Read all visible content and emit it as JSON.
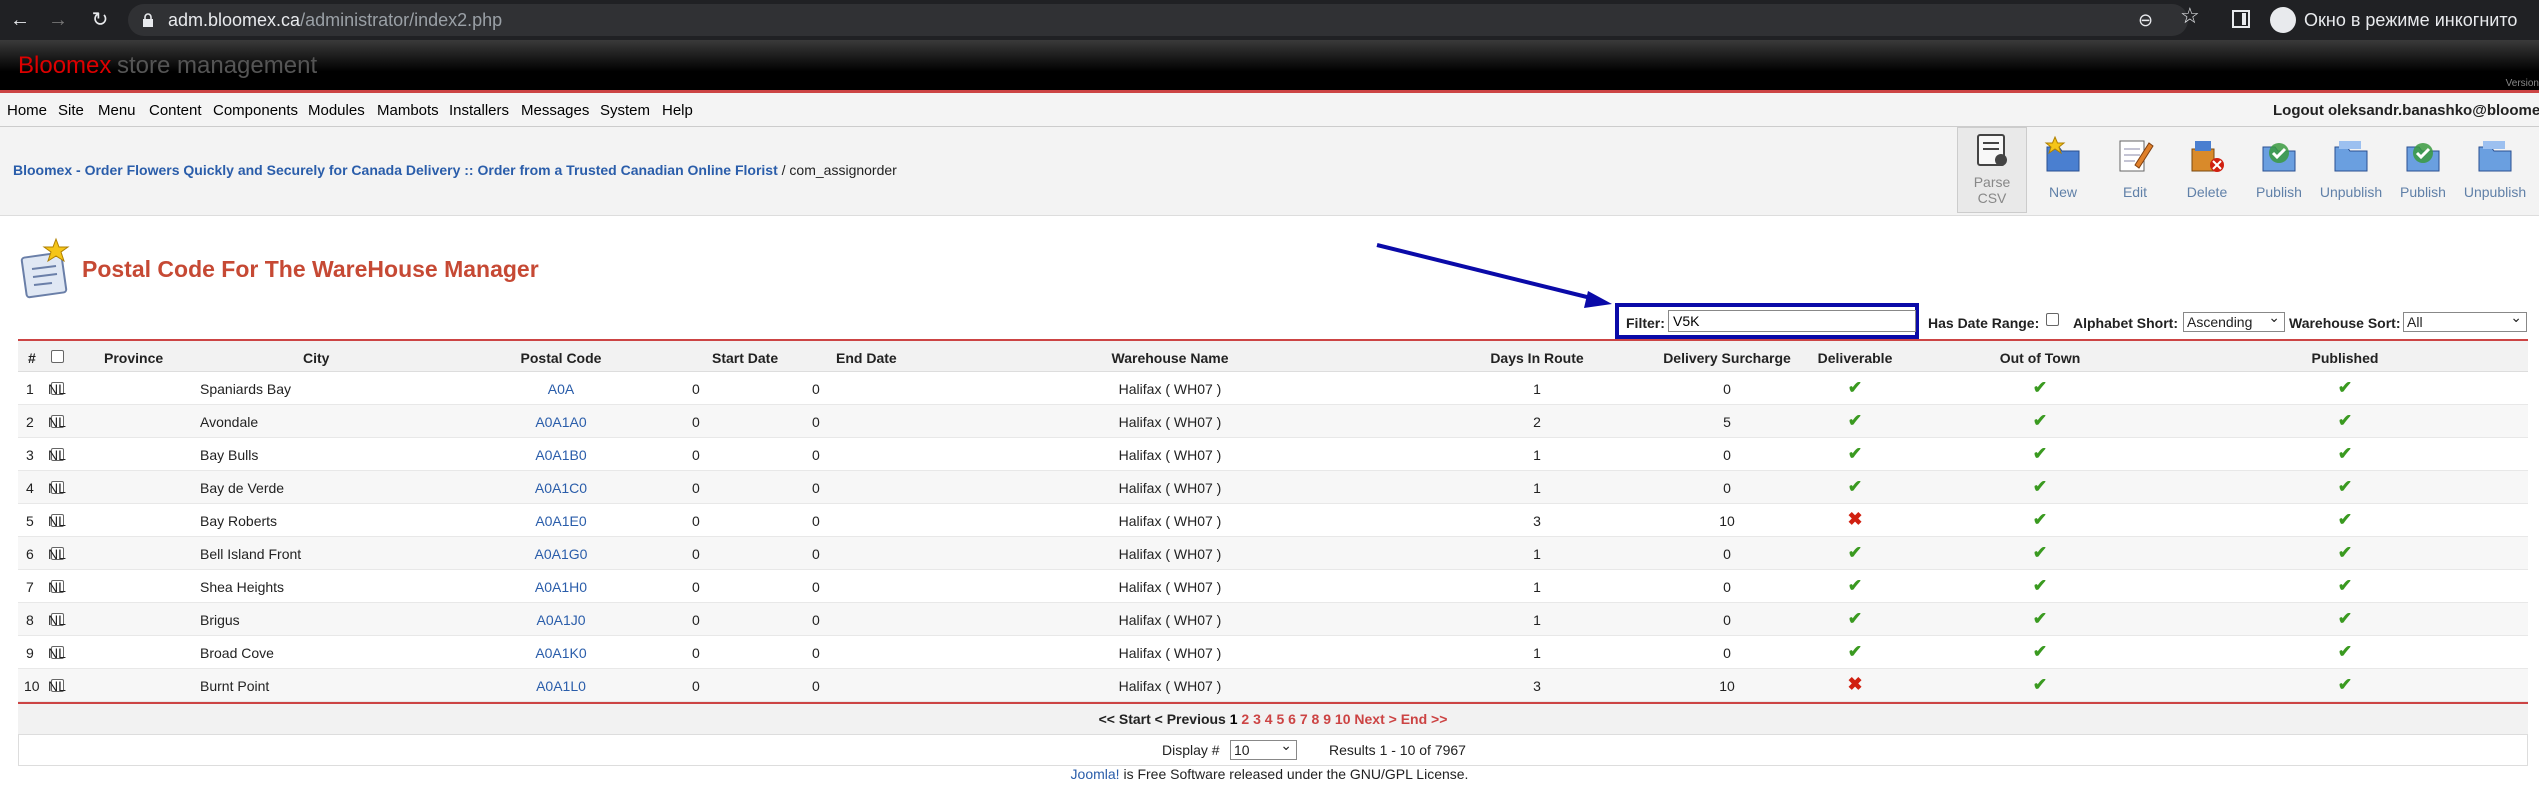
{
  "browser": {
    "url_host": "adm.bloomex.ca",
    "url_path": "/administrator/index2.php",
    "incognito_label": "Окно в режиме инкогнито"
  },
  "header": {
    "brand": "Bloomex",
    "subtitle": "store management",
    "version": "Version"
  },
  "menu": {
    "items": [
      "Home",
      "Site",
      "Menu",
      "Content",
      "Components",
      "Modules",
      "Mambots",
      "Installers",
      "Messages",
      "System",
      "Help"
    ],
    "logout": "Logout oleksandr.banashko@bloomex.c"
  },
  "pathway": {
    "link": "Bloomex - Order Flowers Quickly and Securely for Canada Delivery :: Order from a Trusted Canadian Online Florist",
    "tail": " / com_assignorder"
  },
  "toolbar": {
    "parse_csv": "Parse CSV",
    "new": "New",
    "edit": "Edit",
    "delete": "Delete",
    "publish": "Publish",
    "unpublish": "Unpublish",
    "publish2": "Publish",
    "unpublish2": "Unpublish"
  },
  "page": {
    "title": "Postal Code For The WareHouse Manager"
  },
  "filters": {
    "filter_label": "Filter:",
    "filter_value": "V5K",
    "date_range_label": "Has Date Range:",
    "alpha_label": "Alphabet Short:",
    "alpha_value": "Ascending",
    "wh_sort_label": "Warehouse Sort:",
    "wh_sort_value": "All"
  },
  "table": {
    "headers": {
      "num": "#",
      "province": "Province",
      "city": "City",
      "postal": "Postal Code",
      "start": "Start Date",
      "end": "End Date",
      "warehouse": "Warehouse Name",
      "days": "Days In Route",
      "surcharge": "Delivery Surcharge",
      "deliverable": "Deliverable",
      "outoftown": "Out of Town",
      "published": "Published"
    },
    "rows": [
      {
        "n": "1",
        "province": "NL",
        "city": "Spaniards Bay",
        "code": "A0A",
        "start": "0",
        "end": "0",
        "warehouse": "Halifax ( WH07 )",
        "days": "1",
        "surcharge": "0",
        "deliverable": "✔",
        "outoftown": "✔",
        "published": "✔"
      },
      {
        "n": "2",
        "province": "NL",
        "city": "Avondale",
        "code": "A0A1A0",
        "start": "0",
        "end": "0",
        "warehouse": "Halifax ( WH07 )",
        "days": "2",
        "surcharge": "5",
        "deliverable": "✔",
        "outoftown": "✔",
        "published": "✔"
      },
      {
        "n": "3",
        "province": "NL",
        "city": "Bay Bulls",
        "code": "A0A1B0",
        "start": "0",
        "end": "0",
        "warehouse": "Halifax ( WH07 )",
        "days": "1",
        "surcharge": "0",
        "deliverable": "✔",
        "outoftown": "✔",
        "published": "✔"
      },
      {
        "n": "4",
        "province": "NL",
        "city": "Bay de Verde",
        "code": "A0A1C0",
        "start": "0",
        "end": "0",
        "warehouse": "Halifax ( WH07 )",
        "days": "1",
        "surcharge": "0",
        "deliverable": "✔",
        "outoftown": "✔",
        "published": "✔"
      },
      {
        "n": "5",
        "province": "NL",
        "city": "Bay Roberts",
        "code": "A0A1E0",
        "start": "0",
        "end": "0",
        "warehouse": "Halifax ( WH07 )",
        "days": "3",
        "surcharge": "10",
        "deliverable": "✖",
        "outoftown": "✔",
        "published": "✔"
      },
      {
        "n": "6",
        "province": "NL",
        "city": "Bell Island Front",
        "code": "A0A1G0",
        "start": "0",
        "end": "0",
        "warehouse": "Halifax ( WH07 )",
        "days": "1",
        "surcharge": "0",
        "deliverable": "✔",
        "outoftown": "✔",
        "published": "✔"
      },
      {
        "n": "7",
        "province": "NL",
        "city": "Shea Heights",
        "code": "A0A1H0",
        "start": "0",
        "end": "0",
        "warehouse": "Halifax ( WH07 )",
        "days": "1",
        "surcharge": "0",
        "deliverable": "✔",
        "outoftown": "✔",
        "published": "✔"
      },
      {
        "n": "8",
        "province": "NL",
        "city": "Brigus",
        "code": "A0A1J0",
        "start": "0",
        "end": "0",
        "warehouse": "Halifax ( WH07 )",
        "days": "1",
        "surcharge": "0",
        "deliverable": "✔",
        "outoftown": "✔",
        "published": "✔"
      },
      {
        "n": "9",
        "province": "NL",
        "city": "Broad Cove",
        "code": "A0A1K0",
        "start": "0",
        "end": "0",
        "warehouse": "Halifax ( WH07 )",
        "days": "1",
        "surcharge": "0",
        "deliverable": "✔",
        "outoftown": "✔",
        "published": "✔"
      },
      {
        "n": "10",
        "province": "NL",
        "city": "Burnt Point",
        "code": "A0A1L0",
        "start": "0",
        "end": "0",
        "warehouse": "Halifax ( WH07 )",
        "days": "3",
        "surcharge": "10",
        "deliverable": "✖",
        "outoftown": "✔",
        "published": "✔"
      }
    ]
  },
  "pagination": {
    "start": "<< Start",
    "prev": "< Previous",
    "current": "1",
    "pages": [
      "2",
      "3",
      "4",
      "5",
      "6",
      "7",
      "8",
      "9",
      "10"
    ],
    "next": "Next >",
    "end": "End >>"
  },
  "display": {
    "label": "Display #",
    "value": "10",
    "results": "Results 1 - 10 of 7967"
  },
  "footer": {
    "link": "Joomla!",
    "text": " is Free Software released under the GNU/GPL License."
  }
}
